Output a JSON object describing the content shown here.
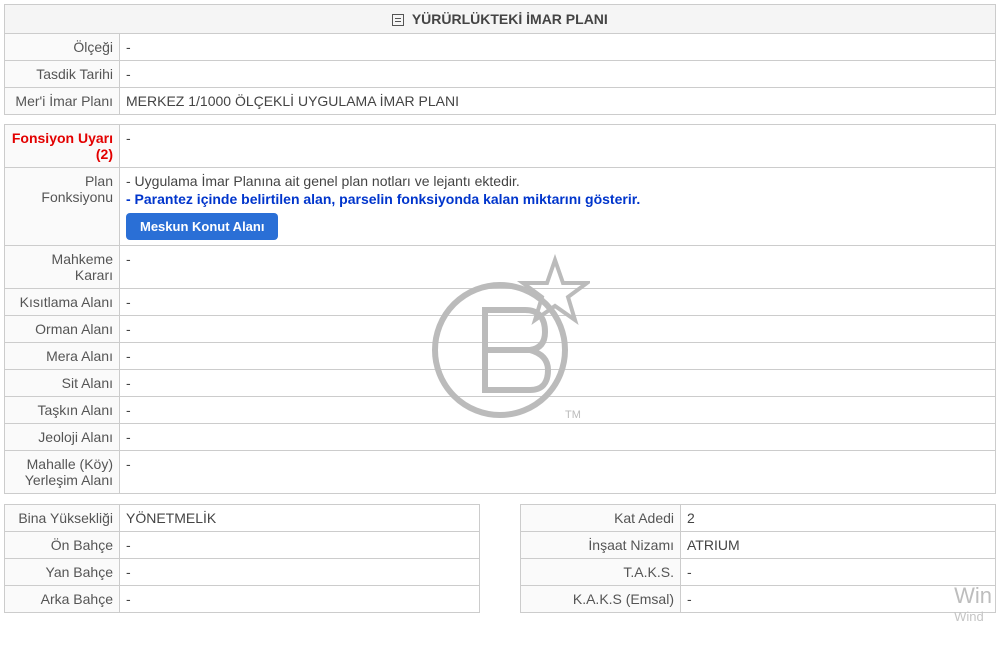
{
  "header": {
    "title": "YÜRÜRLÜKTEKİ İMAR PLANI"
  },
  "top_rows": [
    {
      "label": "Ölçeği",
      "value": "-"
    },
    {
      "label": "Tasdik Tarihi",
      "value": "-"
    },
    {
      "label": "Mer'i İmar Planı",
      "value": "MERKEZ 1/1000 ÖLÇEKLİ UYGULAMA İMAR PLANI"
    }
  ],
  "warning": {
    "label": "Fonsiyon Uyarı",
    "sup": "(2)",
    "value": "-"
  },
  "plan_fonk": {
    "label": "Plan Fonksiyonu",
    "line1": "- Uygulama İmar Planına ait genel plan notları ve lejantı ektedir.",
    "line2": "- Parantez içinde belirtilen alan, parselin fonksiyonda kalan miktarını gösterir.",
    "button": "Meskun Konut Alanı"
  },
  "mid_rows": [
    {
      "label": "Mahkeme Kararı",
      "value": "-"
    },
    {
      "label": "Kısıtlama Alanı",
      "value": "-"
    },
    {
      "label": "Orman Alanı",
      "value": "-"
    },
    {
      "label": "Mera Alanı",
      "value": "-"
    },
    {
      "label": "Sit Alanı",
      "value": "-"
    },
    {
      "label": "Taşkın Alanı",
      "value": "-"
    },
    {
      "label": "Jeoloji Alanı",
      "value": "-"
    },
    {
      "label": "Mahalle (Köy) Yerleşim Alanı",
      "value": "-"
    }
  ],
  "bottom_left": [
    {
      "label": "Bina Yüksekliği",
      "value": "YÖNETMELİK"
    },
    {
      "label": "Ön Bahçe",
      "value": "-"
    },
    {
      "label": "Yan Bahçe",
      "value": "-"
    },
    {
      "label": "Arka Bahçe",
      "value": "-"
    }
  ],
  "bottom_right": [
    {
      "label": "Kat Adedi",
      "value": "2"
    },
    {
      "label": "İnşaat Nizamı",
      "value": "ATRIUM"
    },
    {
      "label": "T.A.K.S.",
      "value": "-"
    },
    {
      "label": "K.A.K.S (Emsal)",
      "value": "-"
    }
  ],
  "watermark_text": {
    "line1": "Win",
    "line2": "Wind"
  }
}
